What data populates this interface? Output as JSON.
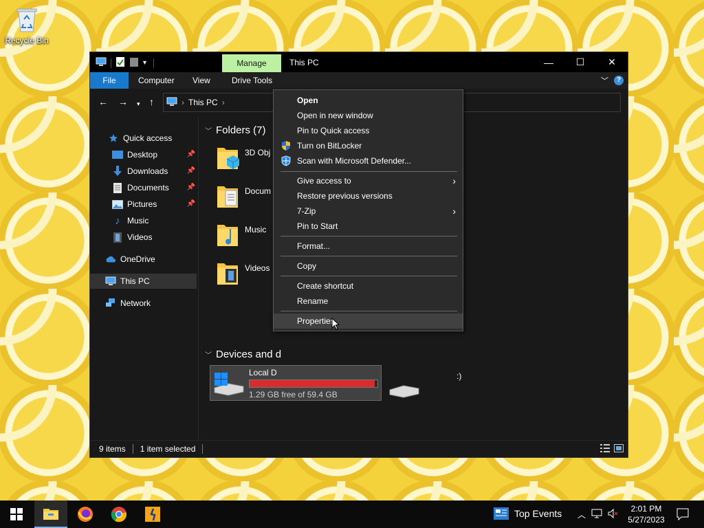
{
  "desktop": {
    "recycle_bin_label": "Recycle Bin"
  },
  "window": {
    "manage_tab": "Manage",
    "title": "This PC",
    "ribbon_tabs": [
      "File",
      "Computer",
      "View",
      "Drive Tools"
    ],
    "address": {
      "crumb": "This PC"
    },
    "controls": {
      "minimize": "—",
      "maximize": "☐",
      "close": "✕"
    },
    "help": "?"
  },
  "tree": {
    "items": [
      {
        "label": "Quick access"
      },
      {
        "label": "Desktop"
      },
      {
        "label": "Downloads"
      },
      {
        "label": "Documents"
      },
      {
        "label": "Pictures"
      },
      {
        "label": "Music"
      },
      {
        "label": "Videos"
      },
      {
        "label": "OneDrive"
      },
      {
        "label": "This PC"
      },
      {
        "label": "Network"
      }
    ]
  },
  "content": {
    "folders_header": "Folders (7)",
    "folders": [
      {
        "name": "3D Obj"
      },
      {
        "name": "Docum"
      },
      {
        "name": "Music"
      },
      {
        "name": "Videos"
      }
    ],
    "devices_header": "Devices and d",
    "drive": {
      "name": "Local D",
      "free": "1.29 GB free of 59.4 GB",
      "used_fraction": 0.978
    },
    "dvd_fragment": ":)"
  },
  "status": {
    "items": "9 items",
    "selected": "1 item selected"
  },
  "context_menu": {
    "items": [
      {
        "label": "Open"
      },
      {
        "label": "Open in new window"
      },
      {
        "label": "Pin to Quick access"
      },
      {
        "label": "Turn on BitLocker"
      },
      {
        "label": "Scan with Microsoft Defender..."
      },
      {
        "label": "Give access to"
      },
      {
        "label": "Restore previous versions"
      },
      {
        "label": "7-Zip"
      },
      {
        "label": "Pin to Start"
      },
      {
        "label": "Format..."
      },
      {
        "label": "Copy"
      },
      {
        "label": "Create shortcut"
      },
      {
        "label": "Rename"
      },
      {
        "label": "Properties"
      }
    ]
  },
  "taskbar": {
    "news": "Top Events",
    "time": "2:01 PM",
    "date": "5/27/2023"
  },
  "colors": {
    "accent": "#1979ca",
    "manage_tab": "#bcf0a2",
    "drive_bar": "#d92b2b"
  }
}
